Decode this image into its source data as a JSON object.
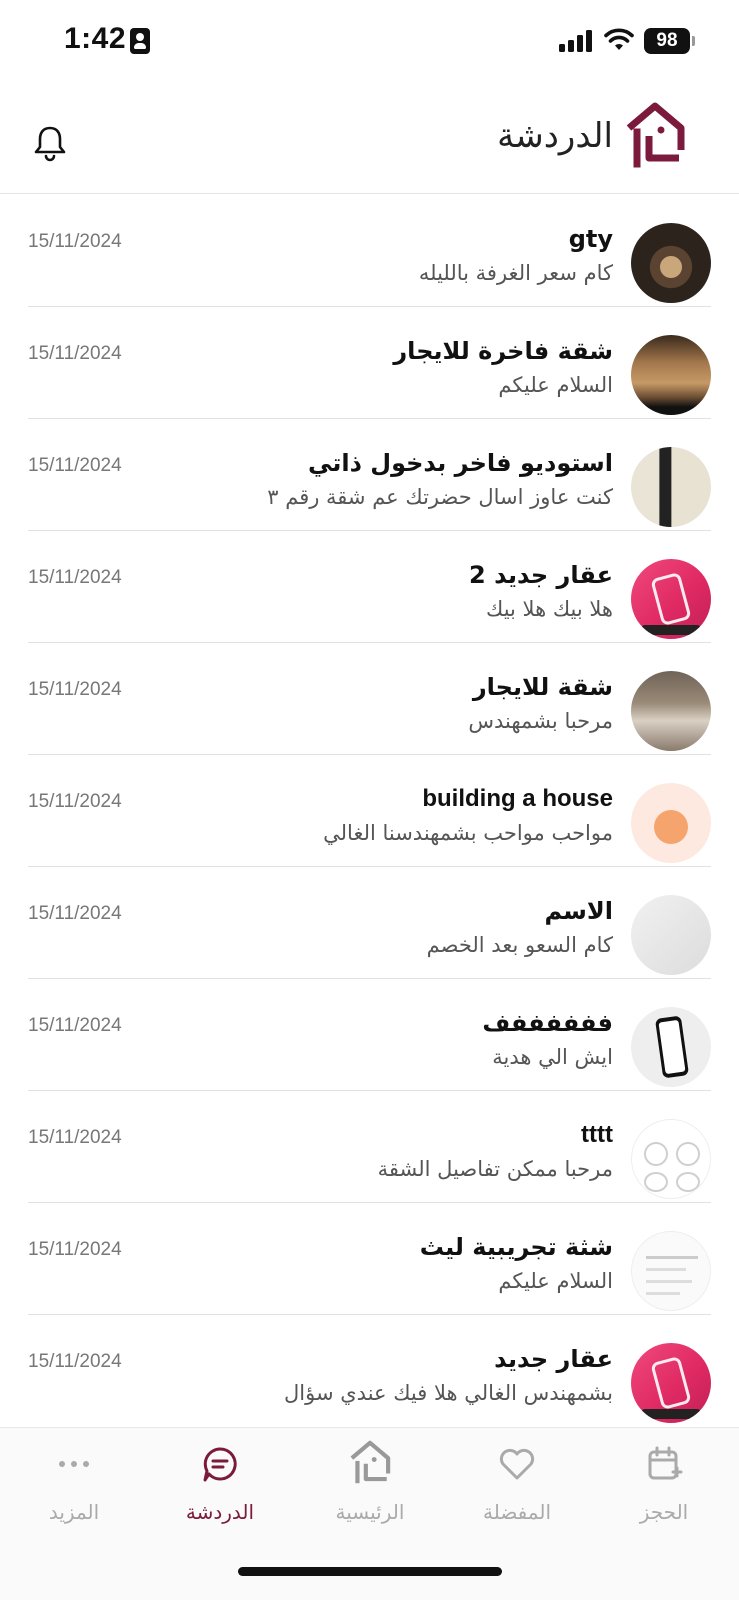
{
  "status_bar": {
    "time": "1:42",
    "battery": "98"
  },
  "header": {
    "title": "الدردشة"
  },
  "chats": [
    {
      "name": "gty",
      "message": "كام سعر الغرفة بالليله",
      "date": "15/11/2024"
    },
    {
      "name": "شقة فاخرة للايجار",
      "message": "السلام عليكم",
      "date": "15/11/2024"
    },
    {
      "name": "استوديو فاخر بدخول ذاتي",
      "message": "كنت عاوز اسال حضرتك عم شقة رقم ٣",
      "date": "15/11/2024"
    },
    {
      "name": "عقار جديد 2",
      "message": "هلا بيك هلا بيك",
      "date": "15/11/2024"
    },
    {
      "name": "شقة  للايجار",
      "message": "مرحبا بشمهندس",
      "date": "15/11/2024"
    },
    {
      "name": "building a house",
      "message": "مواحب مواحب بشمهندسنا الغالي",
      "date": "15/11/2024"
    },
    {
      "name": "الاسم",
      "message": "كام السعو بعد الخصم",
      "date": "15/11/2024"
    },
    {
      "name": "ففففففف",
      "message": "ايش الي هدية",
      "date": "15/11/2024"
    },
    {
      "name": "tttt",
      "message": "مرحبا ممكن تفاصيل الشقة",
      "date": "15/11/2024"
    },
    {
      "name": "شثة تجريبية ليث",
      "message": "السلام عليكم",
      "date": "15/11/2024"
    },
    {
      "name": "عقار جديد",
      "message": "بشمهندس الغالي هلا فيك عندي سؤال",
      "date": "15/11/2024"
    }
  ],
  "bottom_nav": {
    "more": "المزيد",
    "chat": "الدردشة",
    "home": "الرئيسية",
    "favorites": "المفضلة",
    "booking": "الحجز"
  },
  "colors": {
    "brand": "#7b1a3c",
    "inactive": "#aaaaaa"
  }
}
